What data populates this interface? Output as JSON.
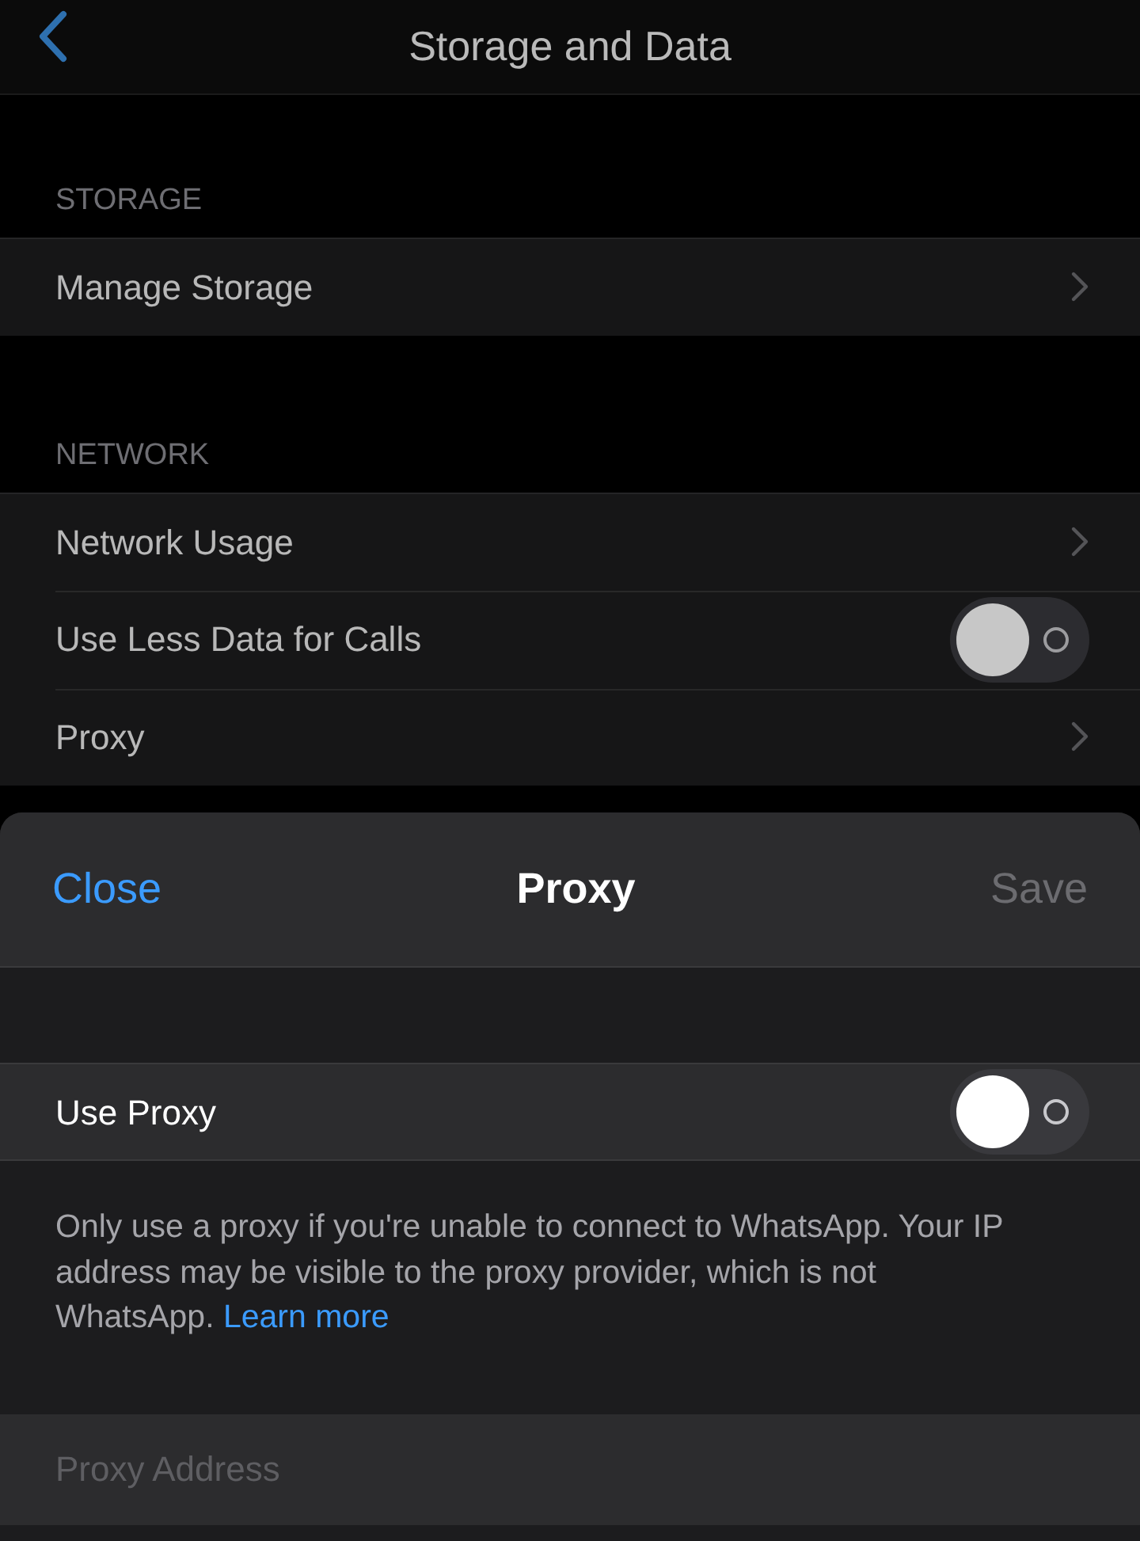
{
  "header": {
    "title": "Storage and Data"
  },
  "sections": [
    {
      "label": "STORAGE",
      "rows": [
        {
          "kind": "link",
          "label": "Manage Storage"
        }
      ]
    },
    {
      "label": "NETWORK",
      "rows": [
        {
          "kind": "link",
          "label": "Network Usage"
        },
        {
          "kind": "toggle",
          "label": "Use Less Data for Calls",
          "on": false
        },
        {
          "kind": "link",
          "label": "Proxy"
        }
      ]
    }
  ],
  "sheet": {
    "close": "Close",
    "title": "Proxy",
    "save": "Save",
    "save_disabled": true,
    "use_proxy": {
      "label": "Use Proxy",
      "on": false
    },
    "note": "Only use a proxy if you're unable to connect to WhatsApp. Your IP address may be visible to the proxy provider, which is not WhatsApp.",
    "learn_more": "Learn more",
    "address": {
      "placeholder": "Proxy Address"
    }
  }
}
